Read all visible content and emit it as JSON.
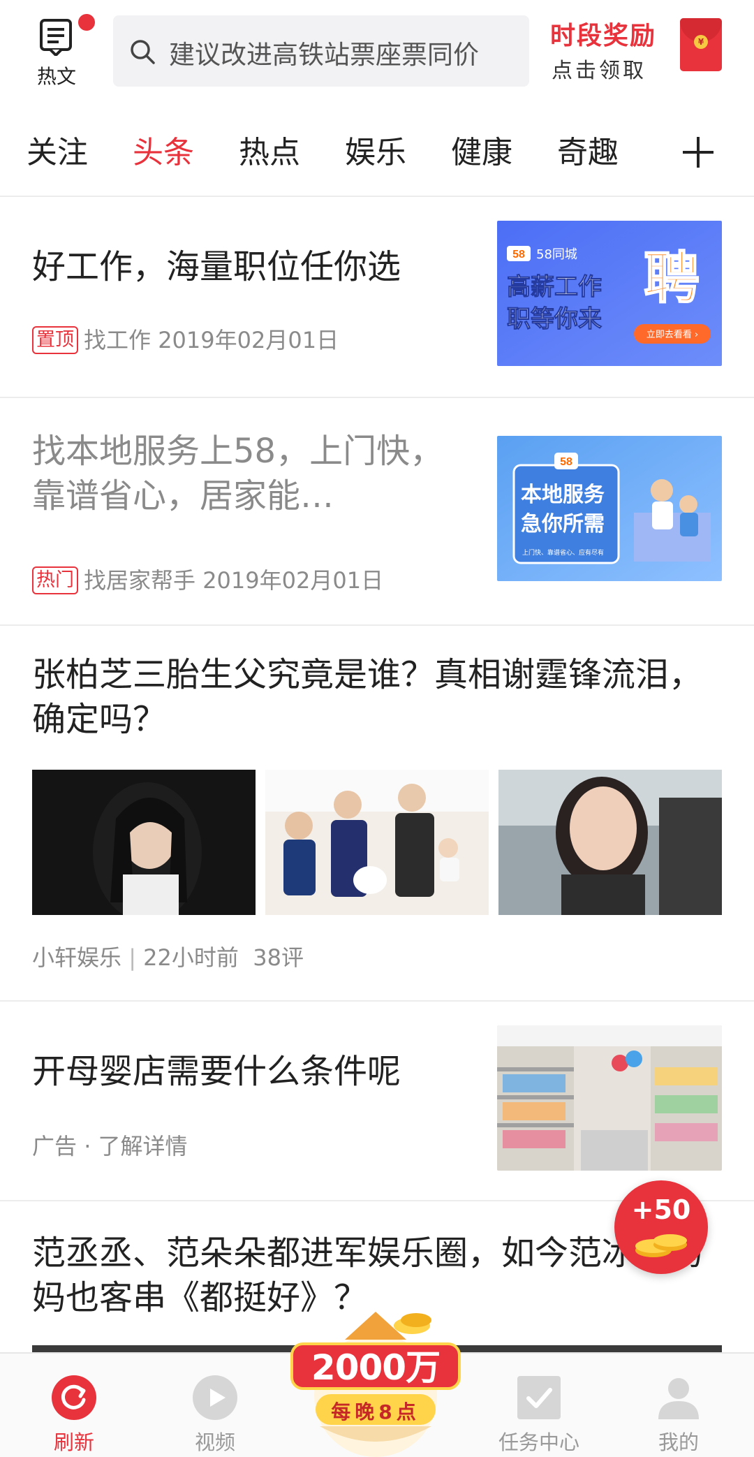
{
  "header": {
    "hot_label": "热文",
    "search_placeholder": "建议改进高铁站票座票同价",
    "reward_title": "时段奖励",
    "reward_sub": "点击领取",
    "envelope_symbol": "¥"
  },
  "tabs": [
    {
      "label": "关注",
      "active": false
    },
    {
      "label": "头条",
      "active": true
    },
    {
      "label": "热点",
      "active": false
    },
    {
      "label": "娱乐",
      "active": false
    },
    {
      "label": "健康",
      "active": false
    },
    {
      "label": "奇趣",
      "active": false
    }
  ],
  "feed": [
    {
      "title": "好工作，海量职位任你选",
      "tag": "置顶",
      "source": "找工作",
      "date": "2019年02月01日",
      "thumb": {
        "brand": "58同城",
        "line1": "高薪工作",
        "line2": "职等你来",
        "big_char": "聘",
        "cta": "立即去看看 ›"
      }
    },
    {
      "title": "找本地服务上58，上门快，靠谱省心，居家能…",
      "tag": "热门",
      "source": "找居家帮手",
      "date": "2019年02月01日",
      "thumb": {
        "brand": "58",
        "line1": "本地服务",
        "line2": "急你所需",
        "caption": "上门快、靠谱省心、应有尽有"
      }
    },
    {
      "title": "张柏芝三胎生父究竟是谁？真相谢霆锋流泪，确定吗？",
      "source": "小轩娱乐",
      "time": "22小时前",
      "comments": "38评"
    },
    {
      "title": "开母婴店需要什么条件呢",
      "ad_label": "广告",
      "ad_link": "了解详情"
    },
    {
      "title": "范丞丞、范朵朵都进军娱乐圈，如今范冰冰妈妈也客串《都挺好》？"
    }
  ],
  "floating": {
    "coin_value": "+50"
  },
  "promo": {
    "amount": "2000万",
    "sub": "每晚8点"
  },
  "bottom_nav": [
    {
      "label": "刷新",
      "icon": "refresh-icon",
      "active": true
    },
    {
      "label": "视频",
      "icon": "play-icon",
      "active": false
    },
    {
      "label": "任务中心",
      "icon": "task-check-icon",
      "active": false
    },
    {
      "label": "我的",
      "icon": "user-icon",
      "active": false
    }
  ],
  "colors": {
    "accent": "#e8323c",
    "text": "#222222",
    "muted": "#8a8a8a"
  }
}
